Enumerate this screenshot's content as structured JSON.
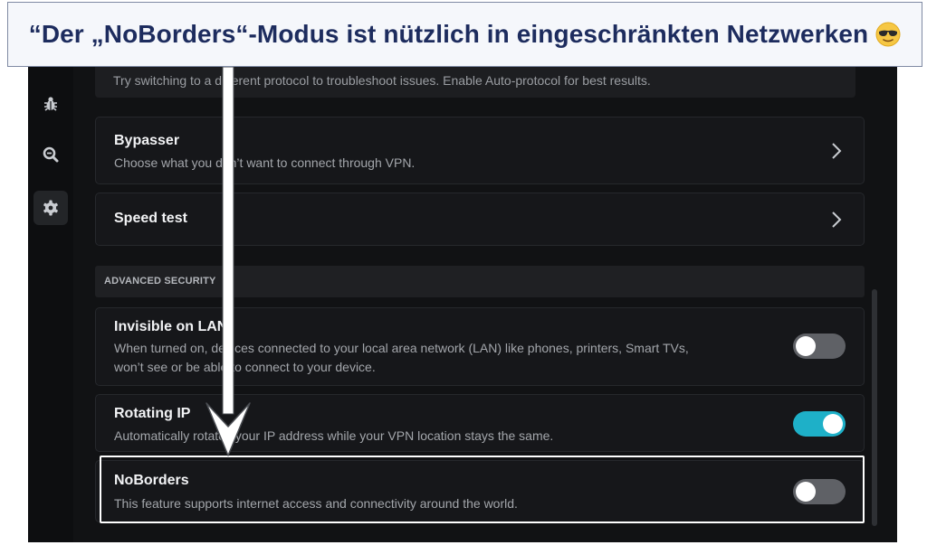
{
  "banner": {
    "text": "“Der „NoBorders“-Modus ist nützlich in eingeschränkten Netzwerken",
    "emoji": "sunglasses-face-emoji"
  },
  "sidebar": {
    "items": [
      {
        "name": "bug-icon",
        "active": false
      },
      {
        "name": "search-icon",
        "active": false
      },
      {
        "name": "gear-icon",
        "active": true
      }
    ]
  },
  "protocol_tip": {
    "text": "Try switching to a different protocol to troubleshoot issues. Enable Auto-protocol for best results."
  },
  "bypasser": {
    "title": "Bypasser",
    "description": "Choose what you don’t want to connect through VPN."
  },
  "speed_test": {
    "title": "Speed test"
  },
  "advanced_security": {
    "header": "ADVANCED SECURITY",
    "items": [
      {
        "title": "Invisible on LAN",
        "description_line1": "When turned on, devices connected to your local area network (LAN) like phones, printers, Smart TVs,",
        "description_line2": "won’t see or be able to connect to your device.",
        "enabled": false
      },
      {
        "title": "Rotating IP",
        "description": "Automatically rotates your IP address while your VPN location stays the same.",
        "enabled": true
      },
      {
        "title": "NoBorders",
        "description": "This feature supports internet access and connectivity around the world.",
        "enabled": false
      }
    ]
  },
  "colors": {
    "toggle_on": "#1eb0c8",
    "toggle_off": "#5f6166",
    "banner_text": "#1d2c5e",
    "background": "#111214"
  }
}
